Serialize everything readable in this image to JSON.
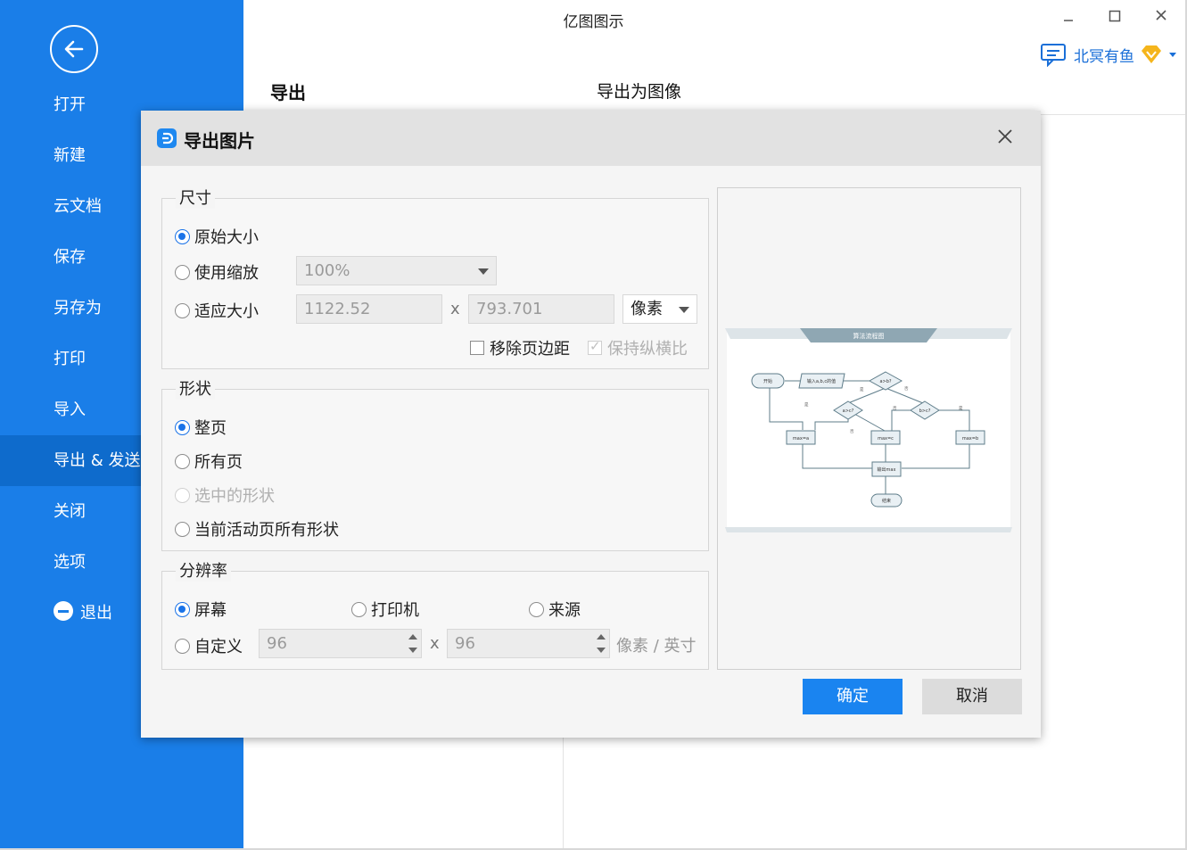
{
  "sidebar": {
    "items": [
      {
        "label": "打开"
      },
      {
        "label": "新建"
      },
      {
        "label": "云文档"
      },
      {
        "label": "保存"
      },
      {
        "label": "另存为"
      },
      {
        "label": "打印"
      },
      {
        "label": "导入"
      },
      {
        "label": "导出 & 发送"
      },
      {
        "label": "关闭"
      },
      {
        "label": "选项"
      },
      {
        "label": "退出"
      }
    ],
    "active_index": 7
  },
  "window": {
    "title": "亿图图示",
    "user_name": "北冥有鱼"
  },
  "page": {
    "heading": "导出",
    "subheading": "导出为图像"
  },
  "dialog": {
    "title": "导出图片",
    "size_group": {
      "legend": "尺寸",
      "original": "原始大小",
      "scale": "使用缩放",
      "scale_value": "100%",
      "fit": "适应大小",
      "width": "1122.52",
      "height": "793.701",
      "x_sep": "x",
      "unit": "像素",
      "remove_margin": "移除页边距",
      "keep_ratio": "保持纵横比"
    },
    "shape_group": {
      "legend": "形状",
      "whole_page": "整页",
      "all_pages": "所有页",
      "selected": "选中的形状",
      "active_page_shapes": "当前活动页所有形状"
    },
    "resolution_group": {
      "legend": "分辨率",
      "screen": "屏幕",
      "printer": "打印机",
      "source": "来源",
      "custom": "自定义",
      "dpi_x": "96",
      "dpi_y": "96",
      "x_sep": "x",
      "unit": "像素 / 英寸"
    },
    "preview": {
      "banner": "算法流程图",
      "nodes": [
        "开始",
        "输入a,b,c的值",
        "a>b?",
        "a>c?",
        "b>c?",
        "max=a",
        "max=c",
        "max=b",
        "输出max",
        "结束"
      ],
      "edge_labels": [
        "是",
        "否",
        "是",
        "否",
        "否",
        "是"
      ]
    },
    "ok_label": "确定",
    "cancel_label": "取消"
  }
}
